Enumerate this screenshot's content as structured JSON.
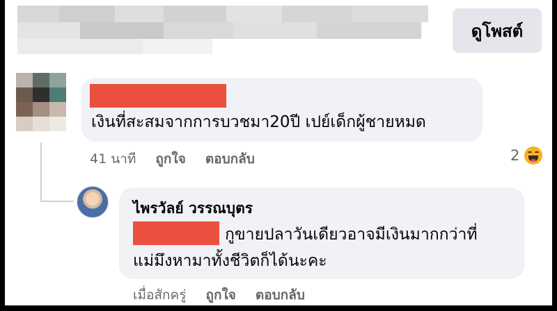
{
  "header": {
    "view_post_label": "ดูโพสต์"
  },
  "comment": {
    "text": "เงินที่สะสมจากการบวชมา20ปี เปย์เด็กผู้ชายหมด",
    "time": "41 นาที",
    "like_label": "ถูกใจ",
    "reply_label": "ตอบกลับ",
    "reaction_count": "2",
    "reaction_icon": "haha-icon"
  },
  "reply": {
    "author": "ไพรวัลย์ วรรณบุตร",
    "line1": "กูขายปลาวันเดียวอาจมีเงินมากกว่าที่",
    "line2": "แม่มึงหามาทั้งชีวิตก็ได้นะคะ",
    "time": "เมื่อสักครู่",
    "like_label": "ถูกใจ",
    "reply_label": "ตอบกลับ"
  },
  "colors": {
    "redaction": "#ea4f3f",
    "bubble": "#f0f2f5",
    "meta": "#65676b"
  }
}
